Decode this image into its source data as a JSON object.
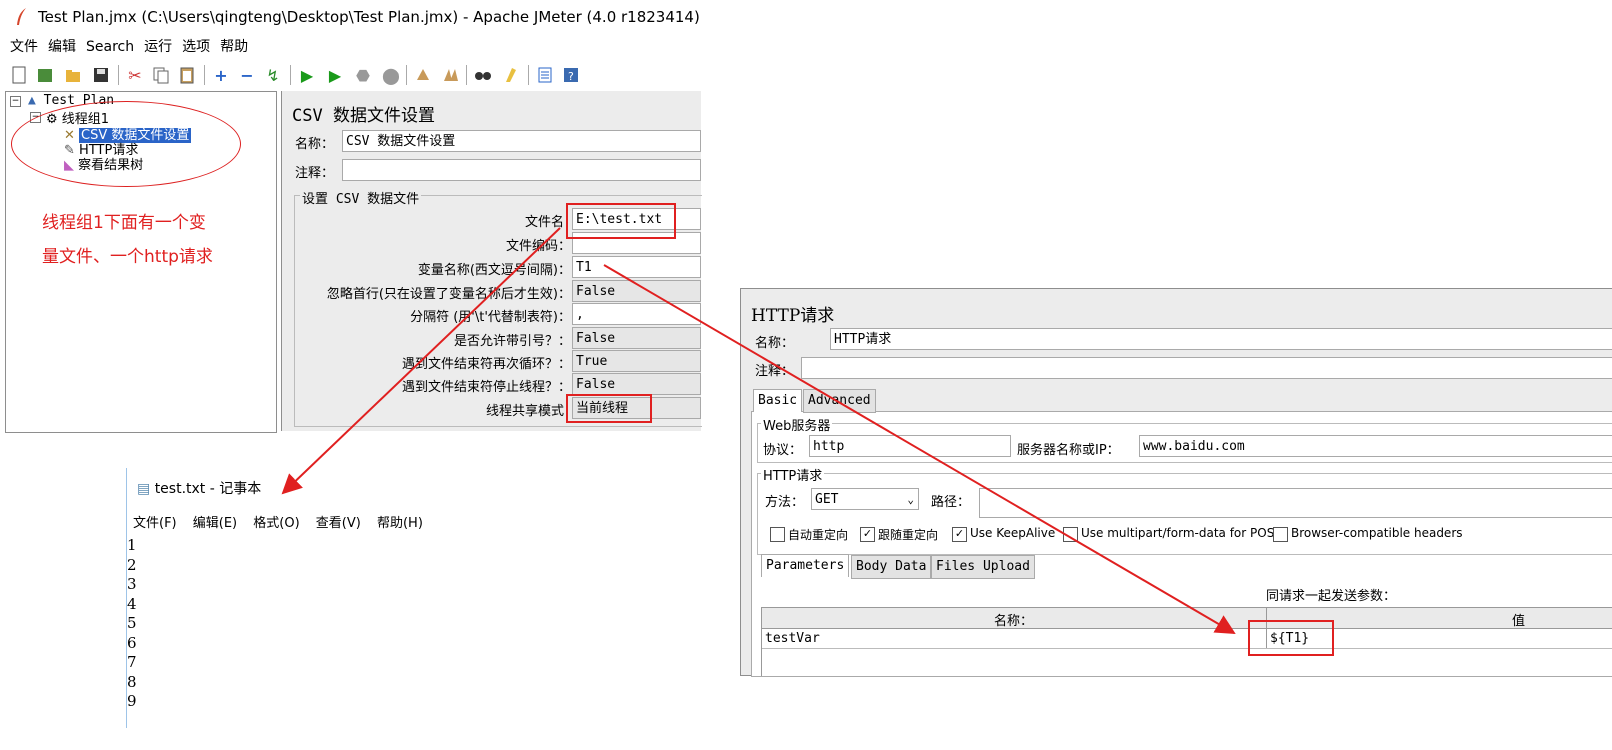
{
  "jmeter": {
    "window_title": "Test Plan.jmx (C:\\Users\\qingteng\\Desktop\\Test Plan.jmx) - Apache JMeter (4.0 r1823414)",
    "menu": [
      "文件",
      "编辑",
      "Search",
      "运行",
      "选项",
      "帮助"
    ],
    "tree": {
      "root": "Test Plan",
      "thread_group": "线程组1",
      "children": [
        "CSV 数据文件设置",
        "HTTP请求",
        "察看结果树"
      ]
    },
    "csv": {
      "title": "CSV 数据文件设置",
      "name_label": "名称：",
      "name_value": "CSV 数据文件设置",
      "comment_label": "注释：",
      "section": "设置 CSV 数据文件",
      "rows": [
        {
          "label": "文件名",
          "value": "E:\\test.txt"
        },
        {
          "label": "文件编码：",
          "value": ""
        },
        {
          "label": "变量名称(西文逗号间隔)：",
          "value": "T1"
        },
        {
          "label": "忽略首行(只在设置了变量名称后才生效)：",
          "value": "False"
        },
        {
          "label": "分隔符 (用'\\t'代替制表符)：",
          "value": ","
        },
        {
          "label": "是否允许带引号？：",
          "value": "False"
        },
        {
          "label": "遇到文件结束符再次循环？：",
          "value": "True"
        },
        {
          "label": "遇到文件结束符停止线程？：",
          "value": "False"
        },
        {
          "label": "线程共享模式",
          "value": "当前线程"
        }
      ]
    }
  },
  "annotation": {
    "line1": "线程组1下面有一个变",
    "line2": "量文件、一个http请求"
  },
  "notepad": {
    "title": "test.txt - 记事本",
    "menu": [
      "文件(F)",
      "编辑(E)",
      "格式(O)",
      "查看(V)",
      "帮助(H)"
    ],
    "lines": [
      "1",
      "2",
      "3",
      "4",
      "5",
      "6",
      "7",
      "8",
      "9"
    ]
  },
  "http": {
    "title": "HTTP请求",
    "name_label": "名称：",
    "name_value": "HTTP请求",
    "comment_label": "注释：",
    "tabs": [
      "Basic",
      "Advanced"
    ],
    "web_server": "Web服务器",
    "protocol_label": "协议：",
    "protocol_value": "http",
    "server_label": "服务器名称或IP：",
    "server_value": "www.baidu.com",
    "http_request_section": "HTTP请求",
    "method_label": "方法：",
    "method_value": "GET",
    "path_label": "路径：",
    "checkboxes": [
      {
        "label": "自动重定向",
        "checked": false
      },
      {
        "label": "跟随重定向",
        "checked": true
      },
      {
        "label": "Use KeepAlive",
        "checked": true
      },
      {
        "label": "Use multipart/form-data for POST",
        "checked": false
      },
      {
        "label": "Browser-compatible headers",
        "checked": false
      }
    ],
    "param_tabs": [
      "Parameters",
      "Body Data",
      "Files Upload"
    ],
    "params_caption": "同请求一起发送参数：",
    "col_name": "名称：",
    "col_value": "值",
    "param_name": "testVar",
    "param_value": "${T1}"
  },
  "colors": {
    "annotation_red": "#e02020",
    "selection": "#2a64c8"
  }
}
